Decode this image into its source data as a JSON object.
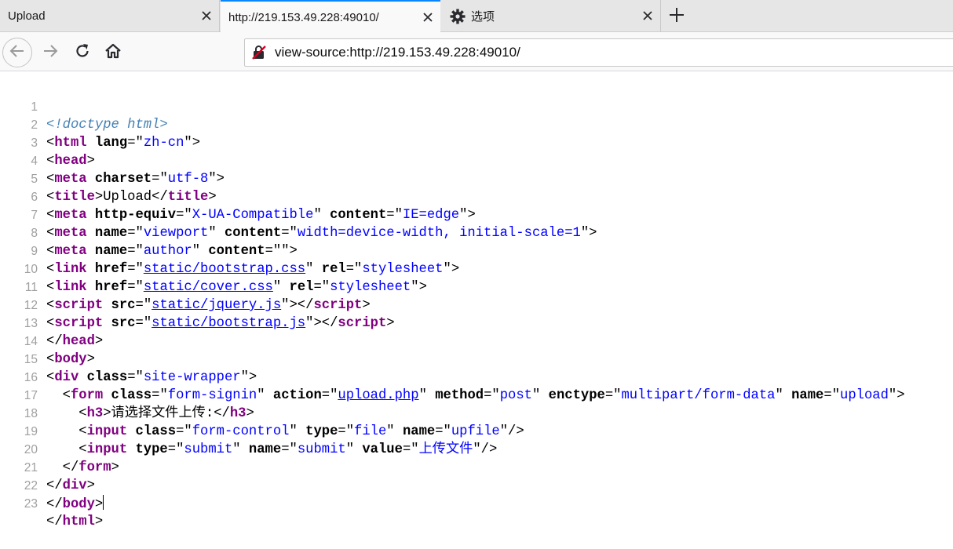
{
  "tabs": [
    {
      "title": "Upload"
    },
    {
      "title": "http://219.153.49.228:49010/"
    },
    {
      "title": "选项"
    }
  ],
  "urlbar": {
    "value": "view-source:http://219.153.49.228:49010/"
  },
  "icons": {
    "back": "arrow-left-icon",
    "forward": "arrow-right-icon",
    "reload": "reload-icon",
    "home": "home-icon",
    "insecure": "insecure-lock-icon",
    "settings": "gear-icon",
    "close": "close-icon",
    "new_tab": "plus-icon"
  },
  "colors": {
    "accent": "#0a84ff",
    "tag": "#800080",
    "attr_value": "#0000ff",
    "line_number": "#a0a0a0"
  },
  "source": {
    "line_numbers": [
      "1",
      "2",
      "3",
      "4",
      "5",
      "6",
      "7",
      "8",
      "9",
      "10",
      "11",
      "12",
      "13",
      "14",
      "15",
      "16",
      "17",
      "18",
      "19",
      "20",
      "21",
      "22",
      "23"
    ],
    "doctype": "<!doctype html>",
    "t": {
      "html": "html",
      "head": "head",
      "meta": "meta",
      "title": "title",
      "link": "link",
      "script": "script",
      "body": "body",
      "div": "div",
      "form": "form",
      "h3": "h3",
      "input": "input"
    },
    "a": {
      "lang": "lang",
      "charset": "charset",
      "http_equiv": "http-equiv",
      "content": "content",
      "name": "name",
      "href": "href",
      "rel": "rel",
      "src": "src",
      "class": "class",
      "action": "action",
      "method": "method",
      "enctype": "enctype",
      "type": "type",
      "value": "value"
    },
    "v": {
      "zh_cn": "zh-cn",
      "utf8": "utf-8",
      "xua": "X-UA-Compatible",
      "ie_edge": "IE=edge",
      "viewport": "viewport",
      "viewport_content": "width=device-width, initial-scale=1",
      "author": "author",
      "empty": "",
      "bootstrap_css": "static/bootstrap.css",
      "cover_css": "static/cover.css",
      "stylesheet": "stylesheet",
      "jquery_js": "static/jquery.js",
      "bootstrap_js": "static/bootstrap.js",
      "site_wrapper": "site-wrapper",
      "form_signin": "form-signin",
      "upload_php": "upload.php",
      "post": "post",
      "multipart": "multipart/form-data",
      "upload": "upload",
      "form_control": "form-control",
      "file": "file",
      "upfile": "upfile",
      "submit": "submit",
      "submit_value": "上传文件"
    },
    "text": {
      "title": "Upload",
      "h3": "请选择文件上传:"
    }
  }
}
